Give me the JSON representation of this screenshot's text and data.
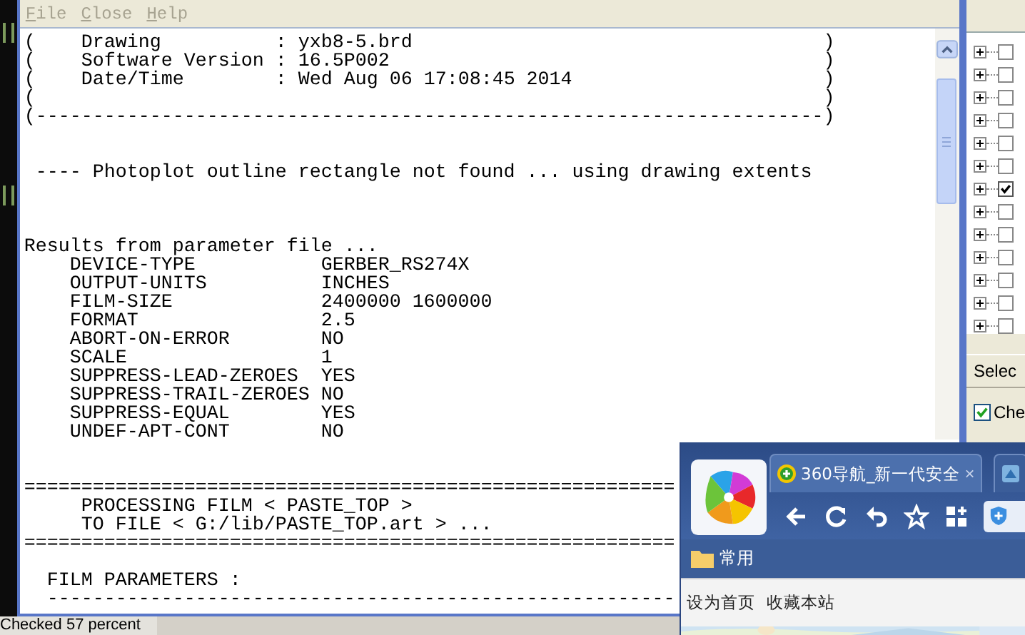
{
  "menu": [
    {
      "label": "File",
      "disabled": true
    },
    {
      "label": "Close",
      "disabled": true
    },
    {
      "label": "Help",
      "disabled": true
    }
  ],
  "log": {
    "header": [
      "(    Drawing          : yxb8-5.brd                                    )",
      "(    Software Version : 16.5P002                                      )",
      "(    Date/Time        : Wed Aug 06 17:08:45 2014                      )",
      "(                                                                     )",
      "(---------------------------------------------------------------------)"
    ],
    "notice": "---- Photoplot outline rectangle not found ... using drawing extents",
    "results_title": "Results from parameter file ...",
    "parameters": [
      {
        "name": "DEVICE-TYPE",
        "value": "GERBER_RS274X"
      },
      {
        "name": "OUTPUT-UNITS",
        "value": "INCHES"
      },
      {
        "name": "FILM-SIZE",
        "value": "2400000 1600000"
      },
      {
        "name": "FORMAT",
        "value": "2.5"
      },
      {
        "name": "ABORT-ON-ERROR",
        "value": "NO"
      },
      {
        "name": "SCALE",
        "value": "1"
      },
      {
        "name": "SUPPRESS-LEAD-ZEROES",
        "value": "YES"
      },
      {
        "name": "SUPPRESS-TRAIL-ZEROES",
        "value": "NO"
      },
      {
        "name": "SUPPRESS-EQUAL",
        "value": "YES"
      },
      {
        "name": "UNDEF-APT-CONT",
        "value": "NO"
      }
    ],
    "rule_double": "=========================================================",
    "film_lines": [
      "PROCESSING FILM < PASTE_TOP >",
      "TO FILE < G:/lib/PASTE_TOP.art > ..."
    ],
    "film_parameters": "FILM PARAMETERS :",
    "rule_single": "-------------------------------------------------------"
  },
  "tree": [
    {
      "checked": false
    },
    {
      "checked": false
    },
    {
      "checked": false
    },
    {
      "checked": false
    },
    {
      "checked": false
    },
    {
      "checked": false
    },
    {
      "checked": true
    },
    {
      "checked": false
    },
    {
      "checked": false
    },
    {
      "checked": false
    },
    {
      "checked": false
    },
    {
      "checked": false
    },
    {
      "checked": false
    }
  ],
  "select_button": "Selec",
  "check_option": {
    "label": "Che",
    "checked": true
  },
  "status": "Checked 57 percent",
  "browser": {
    "tabs": [
      {
        "title": "360导航_新一代安全",
        "close": "×",
        "selected": true
      },
      {
        "selected": false
      }
    ],
    "bookmarks": [
      {
        "label": "常用"
      }
    ],
    "page_links": [
      "设为首页",
      "收藏本站"
    ]
  }
}
